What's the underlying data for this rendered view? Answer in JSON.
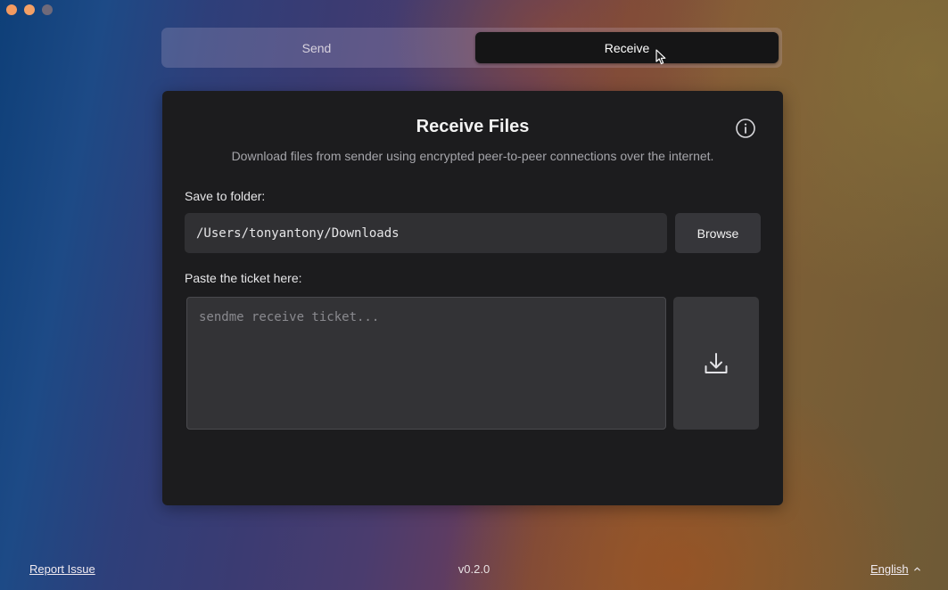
{
  "tabs": [
    {
      "label": "Send",
      "active": false
    },
    {
      "label": "Receive",
      "active": true
    }
  ],
  "card": {
    "title": "Receive Files",
    "description": "Download files from sender using encrypted peer-to-peer connections over the internet.",
    "folder_label": "Save to folder:",
    "folder_path": "/Users/tonyantony/Downloads",
    "browse_label": "Browse",
    "ticket_label": "Paste the ticket here:",
    "ticket_value": "",
    "ticket_placeholder": "sendme receive ticket..."
  },
  "footer": {
    "report_issue": "Report Issue",
    "version": "v0.2.0",
    "language": "English"
  },
  "icons": {
    "info": "info-icon",
    "download": "download-icon",
    "language_toggle": "chevron-up-icon"
  },
  "colors": {
    "card_bg": "#1c1c1e",
    "active_tab_bg": "#151516",
    "field_bg": "#303033"
  }
}
